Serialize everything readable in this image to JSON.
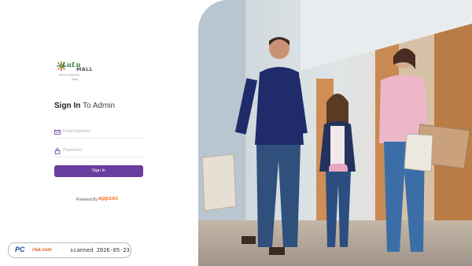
{
  "logo": {
    "name": "LuLu",
    "sub": "MALL",
    "tagline": "World of Happiness",
    "city": "Kochi"
  },
  "login": {
    "title_bold": "Sign In",
    "title_rest": "To Admin",
    "email_placeholder": "Email Address",
    "password_placeholder": "Password",
    "submit_label": "Sign In"
  },
  "footer": {
    "powered_by": "Powered By",
    "brand": "appzoc"
  },
  "watermark": {
    "logo_pc": "PC",
    "logo_risk": "risk.com",
    "scanned_text": "scanned 2026-05-23"
  },
  "colors": {
    "primary": "#6a3ea1",
    "brand_orange": "#ff6b2b"
  },
  "icons": {
    "email": "envelope-icon",
    "password": "lock-icon"
  }
}
